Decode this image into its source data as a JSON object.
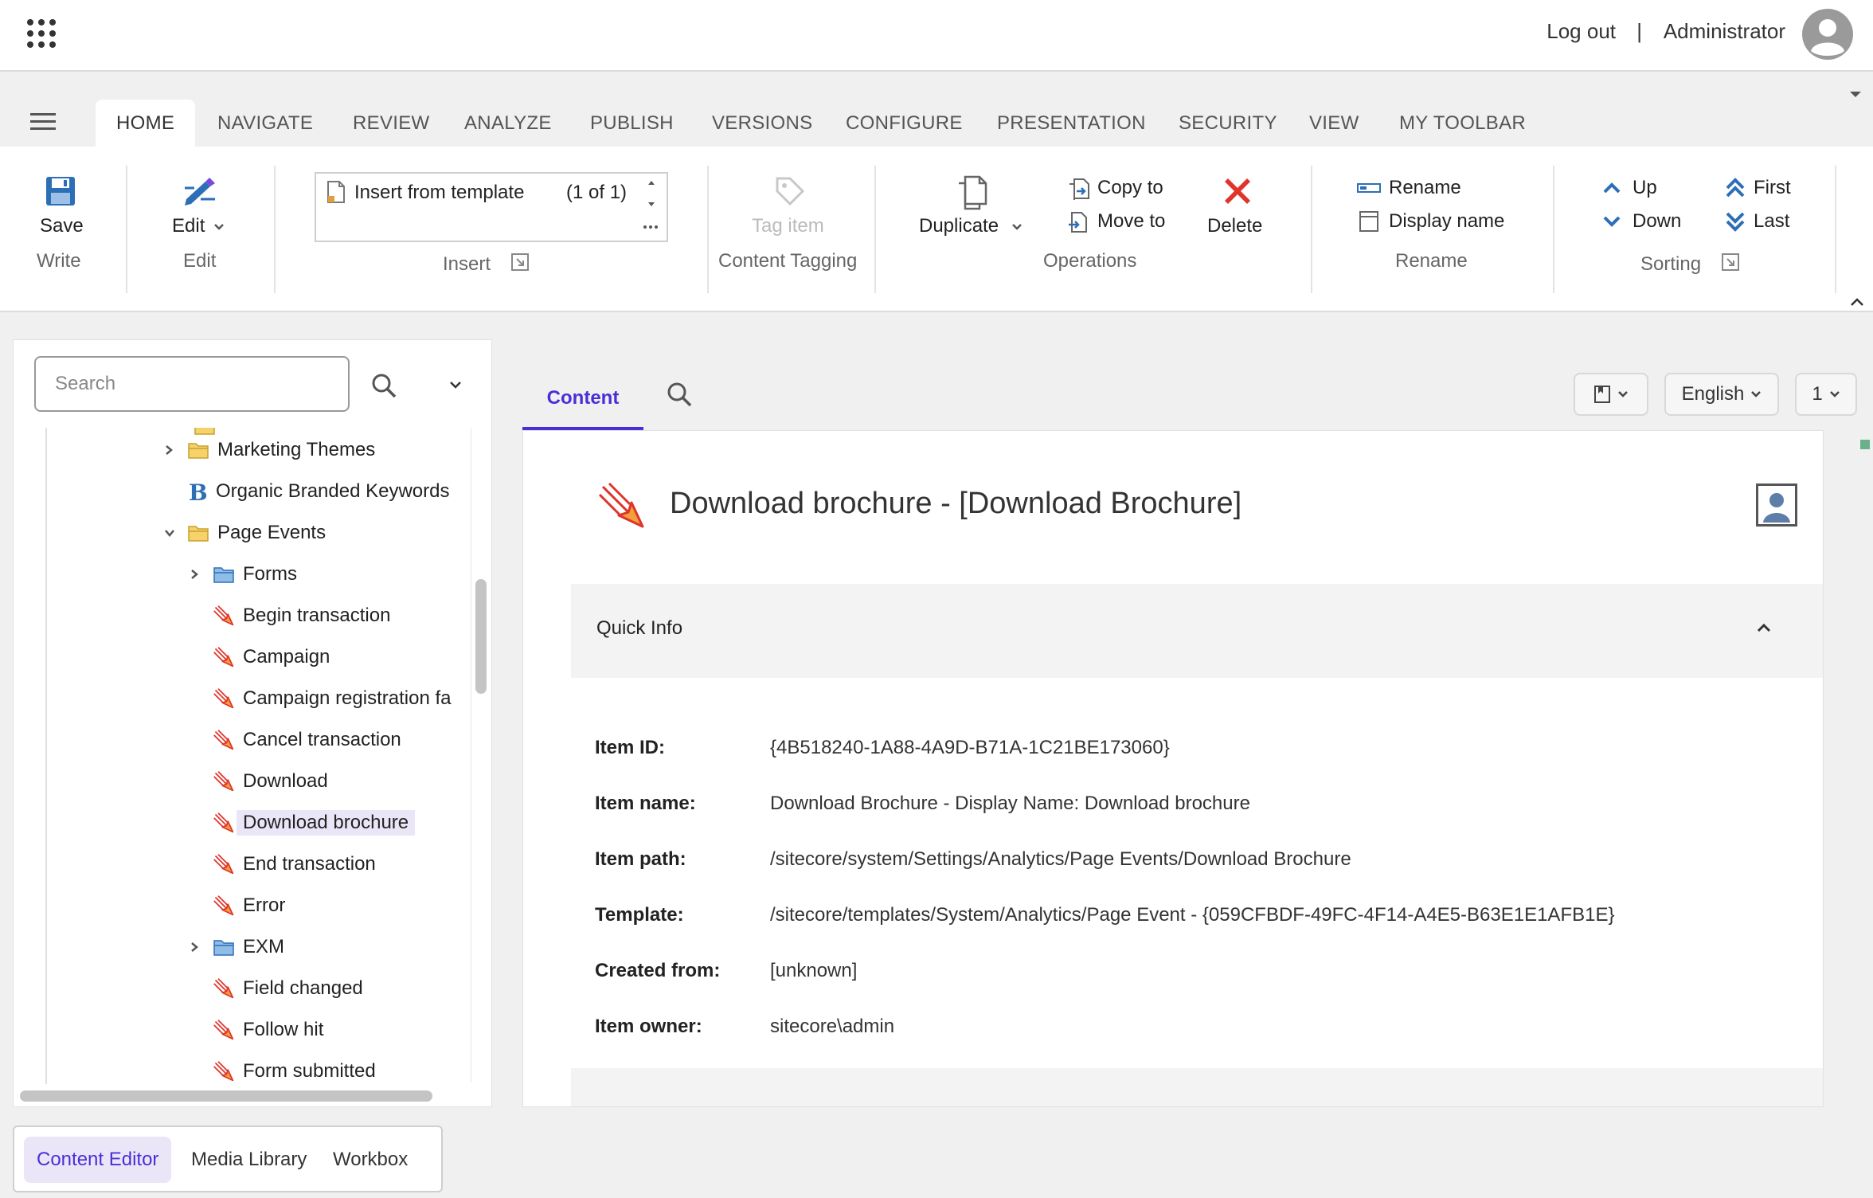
{
  "header": {
    "logout": "Log out",
    "separator": "|",
    "username": "Administrator"
  },
  "ribbon_tabs": [
    "HOME",
    "NAVIGATE",
    "REVIEW",
    "ANALYZE",
    "PUBLISH",
    "VERSIONS",
    "CONFIGURE",
    "PRESENTATION",
    "SECURITY",
    "VIEW",
    "MY TOOLBAR"
  ],
  "ribbon": {
    "write": {
      "save": "Save",
      "label": "Write"
    },
    "edit": {
      "edit": "Edit",
      "label": "Edit"
    },
    "insert": {
      "item": "Insert from template",
      "count": "(1 of 1)",
      "label": "Insert"
    },
    "tagging": {
      "tag": "Tag item",
      "label": "Content Tagging"
    },
    "operations": {
      "duplicate": "Duplicate",
      "copy_to": "Copy to",
      "move_to": "Move to",
      "delete": "Delete",
      "label": "Operations"
    },
    "rename": {
      "rename": "Rename",
      "display_name": "Display name",
      "label": "Rename"
    },
    "sorting": {
      "up": "Up",
      "down": "Down",
      "first": "First",
      "last": "Last",
      "label": "Sorting"
    }
  },
  "search": {
    "placeholder": "Search"
  },
  "tree": [
    {
      "label": "Marketing Themes",
      "icon": "folder-icon",
      "depth": 0,
      "expander": "collapsed"
    },
    {
      "label": "Organic Branded Keywords",
      "icon": "b-icon",
      "depth": 0,
      "expander": "none"
    },
    {
      "label": "Page Events",
      "icon": "folder-icon",
      "depth": 0,
      "expander": "expanded"
    },
    {
      "label": "Forms",
      "icon": "blue-folder-icon",
      "depth": 1,
      "expander": "collapsed"
    },
    {
      "label": "Begin transaction",
      "icon": "page-event-icon",
      "depth": 1,
      "expander": "none"
    },
    {
      "label": "Campaign",
      "icon": "page-event-icon",
      "depth": 1,
      "expander": "none"
    },
    {
      "label": "Campaign registration fa",
      "icon": "page-event-icon",
      "depth": 1,
      "expander": "none"
    },
    {
      "label": "Cancel transaction",
      "icon": "page-event-icon",
      "depth": 1,
      "expander": "none"
    },
    {
      "label": "Download",
      "icon": "page-event-icon",
      "depth": 1,
      "expander": "none"
    },
    {
      "label": "Download brochure",
      "icon": "page-event-icon",
      "depth": 1,
      "expander": "none",
      "selected": true
    },
    {
      "label": "End transaction",
      "icon": "page-event-icon",
      "depth": 1,
      "expander": "none"
    },
    {
      "label": "Error",
      "icon": "page-event-icon",
      "depth": 1,
      "expander": "none"
    },
    {
      "label": "EXM",
      "icon": "blue-folder-icon",
      "depth": 1,
      "expander": "collapsed"
    },
    {
      "label": "Field changed",
      "icon": "page-event-icon",
      "depth": 1,
      "expander": "none"
    },
    {
      "label": "Follow hit",
      "icon": "page-event-icon",
      "depth": 1,
      "expander": "none"
    },
    {
      "label": "Form submitted",
      "icon": "page-event-icon",
      "depth": 1,
      "expander": "none"
    }
  ],
  "bottom_tabs": [
    "Content Editor",
    "Media Library",
    "Workbox"
  ],
  "content_tabs": {
    "content": "Content"
  },
  "controls": {
    "language": "English",
    "version": "1"
  },
  "item": {
    "title": "Download brochure - [Download Brochure]",
    "section": "Quick Info",
    "fields": [
      {
        "label": "Item ID:",
        "value": "{4B518240-1A88-4A9D-B71A-1C21BE173060}"
      },
      {
        "label": "Item name:",
        "value": "Download Brochure - Display Name: Download brochure"
      },
      {
        "label": "Item path:",
        "value": "/sitecore/system/Settings/Analytics/Page Events/Download Brochure"
      },
      {
        "label": "Template:",
        "value": "/sitecore/templates/System/Analytics/Page Event - {059CFBDF-49FC-4F14-A4E5-B63E1E1AFB1E}"
      },
      {
        "label": "Created from:",
        "value": "[unknown]"
      },
      {
        "label": "Item owner:",
        "value": "sitecore\\admin"
      }
    ]
  },
  "colors": {
    "accent": "#4b2ed8",
    "selected_bg": "#ebe6f7",
    "delete": "#e0332a",
    "icon_blue": "#2d6fb6"
  }
}
